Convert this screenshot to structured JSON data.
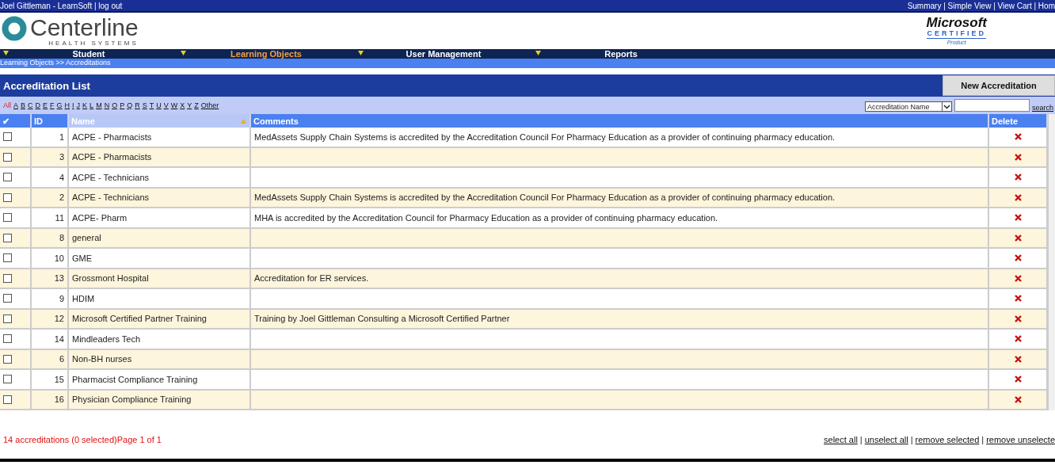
{
  "top_bar": {
    "user_text": "Joel Gittleman - LearnSoft | log out",
    "links_text": "Summary | Simple View | View Cart | Hom"
  },
  "logo": {
    "name": "Centerline",
    "tagline": "HEALTH SYSTEMS"
  },
  "badge": {
    "brand": "Microsoft",
    "certified": "CERTIFIED",
    "product": "Product"
  },
  "nav": [
    {
      "label": "Student",
      "selected": false
    },
    {
      "label": "Learning Objects",
      "selected": true
    },
    {
      "label": "User Management",
      "selected": false
    },
    {
      "label": "Reports",
      "selected": false
    }
  ],
  "breadcrumb": "Learning Objects >> Accreditations",
  "title": "Accreditation List",
  "new_button": "New Accreditation",
  "letters": [
    {
      "label": "All",
      "selected": true
    },
    {
      "label": "A",
      "selected": false
    },
    {
      "label": "B",
      "selected": false
    },
    {
      "label": "C",
      "selected": false
    },
    {
      "label": "D",
      "selected": false
    },
    {
      "label": "E",
      "selected": false
    },
    {
      "label": "F",
      "selected": false
    },
    {
      "label": "G",
      "selected": false
    },
    {
      "label": "H",
      "selected": false
    },
    {
      "label": "I",
      "selected": false
    },
    {
      "label": "J",
      "selected": false
    },
    {
      "label": "K",
      "selected": false
    },
    {
      "label": "L",
      "selected": false
    },
    {
      "label": "M",
      "selected": false
    },
    {
      "label": "N",
      "selected": false
    },
    {
      "label": "O",
      "selected": false
    },
    {
      "label": "P",
      "selected": false
    },
    {
      "label": "Q",
      "selected": false
    },
    {
      "label": "R",
      "selected": false
    },
    {
      "label": "S",
      "selected": false
    },
    {
      "label": "T",
      "selected": false
    },
    {
      "label": "U",
      "selected": false
    },
    {
      "label": "V",
      "selected": false
    },
    {
      "label": "W",
      "selected": false
    },
    {
      "label": "X",
      "selected": false
    },
    {
      "label": "Y",
      "selected": false
    },
    {
      "label": "Z",
      "selected": false
    },
    {
      "label": "Other",
      "selected": false
    }
  ],
  "search": {
    "field": "Accreditation Name",
    "link": "search"
  },
  "table": {
    "columns": [
      {
        "label": "✔",
        "kind": "check"
      },
      {
        "label": "ID",
        "kind": "id"
      },
      {
        "label": "Name",
        "kind": "name"
      },
      {
        "label": "Comments",
        "kind": "text"
      },
      {
        "label": "Delete",
        "kind": "delete"
      }
    ],
    "rows": [
      {
        "checked": false,
        "id": "1",
        "name": "ACPE - Pharmacists",
        "comments": "MedAssets Supply Chain Systems is accredited by the Accreditation Council For Pharmacy Education as a provider of continuing pharmacy education."
      },
      {
        "checked": false,
        "id": "3",
        "name": "ACPE - Pharmacists"
      },
      {
        "checked": false,
        "id": "4",
        "name": "ACPE - Technicians"
      },
      {
        "checked": false,
        "id": "2",
        "name": "ACPE - Technicians",
        "comments": "MedAssets Supply Chain Systems is accredited by the Accreditation Council For Pharmacy Education as a provider of continuing pharmacy education."
      },
      {
        "checked": false,
        "id": "11",
        "name": "ACPE- Pharm",
        "comments": "MHA is accredited by the Accreditation Council for Pharmacy Education as a provider of continuing pharmacy education."
      },
      {
        "checked": false,
        "id": "8",
        "name": "general"
      },
      {
        "checked": false,
        "id": "10",
        "name": "GME"
      },
      {
        "checked": false,
        "id": "13",
        "name": "Grossmont Hospital",
        "comments": "Accreditation for ER services."
      },
      {
        "checked": false,
        "id": "9",
        "name": "HDIM"
      },
      {
        "checked": false,
        "id": "12",
        "name": "Microsoft Certified Partner Training",
        "comments": "Training by Joel Gittleman Consulting a Microsoft Certified Partner"
      },
      {
        "checked": false,
        "id": "14",
        "name": "Mindleaders Tech"
      },
      {
        "checked": false,
        "id": "6",
        "name": "Non-BH nurses"
      },
      {
        "checked": false,
        "id": "15",
        "name": "Pharmacist Compliance Training"
      },
      {
        "checked": false,
        "id": "16",
        "name": "Physician Compliance Training"
      }
    ]
  },
  "footer": {
    "summary": "14 accreditations (0 selected)Page 1 of 1",
    "links": [
      {
        "label": "select all",
        "separator": "|"
      },
      {
        "label": "unselect all",
        "separator": "|"
      },
      {
        "label": "remove selected",
        "separator": "|"
      },
      {
        "label": "remove unselecte"
      }
    ]
  }
}
